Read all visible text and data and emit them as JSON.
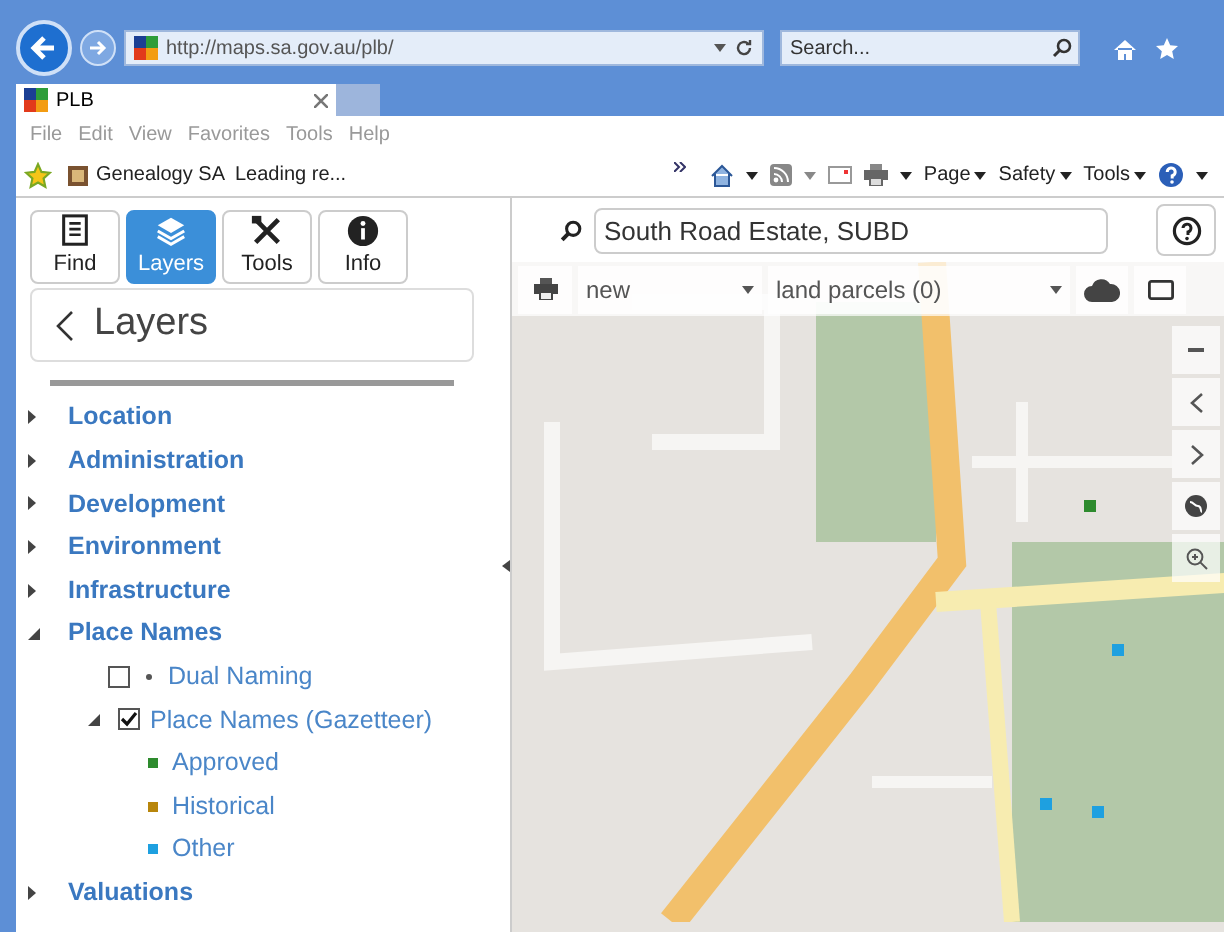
{
  "browser": {
    "address": "http://maps.sa.gov.au/plb/",
    "search_placeholder": "Search...",
    "tab_title": "PLB",
    "menu": [
      "File",
      "Edit",
      "View",
      "Favorites",
      "Tools",
      "Help"
    ],
    "favorites": [
      "Genealogy SA  Leading re..."
    ],
    "commands": [
      "Page",
      "Safety",
      "Tools"
    ]
  },
  "app": {
    "tools": [
      {
        "label": "Find",
        "selected": false
      },
      {
        "label": "Layers",
        "selected": true
      },
      {
        "label": "Tools",
        "selected": false
      },
      {
        "label": "Info",
        "selected": false
      }
    ],
    "search_value": "South Road Estate, SUBD",
    "panel_title": "Layers",
    "layers": [
      {
        "label": "Location",
        "expanded": false
      },
      {
        "label": "Administration",
        "expanded": false
      },
      {
        "label": "Development",
        "expanded": false
      },
      {
        "label": "Environment",
        "expanded": false
      },
      {
        "label": "Infrastructure",
        "expanded": false
      },
      {
        "label": "Place Names",
        "expanded": true,
        "children": [
          {
            "kind": "checkbox",
            "label": "Dual Naming",
            "checked": false
          },
          {
            "kind": "group",
            "label": "Place Names (Gazetteer)",
            "checked": true,
            "expanded": true,
            "children": [
              {
                "label": "Approved",
                "color": "#2e8b2e"
              },
              {
                "label": "Historical",
                "color": "#b8860b"
              },
              {
                "label": "Other",
                "color": "#1ea0e0"
              }
            ]
          }
        ]
      },
      {
        "label": "Valuations",
        "expanded": false
      }
    ],
    "map_toolbar": {
      "draw_select": "new",
      "parcels_select": "land parcels (0)"
    }
  }
}
